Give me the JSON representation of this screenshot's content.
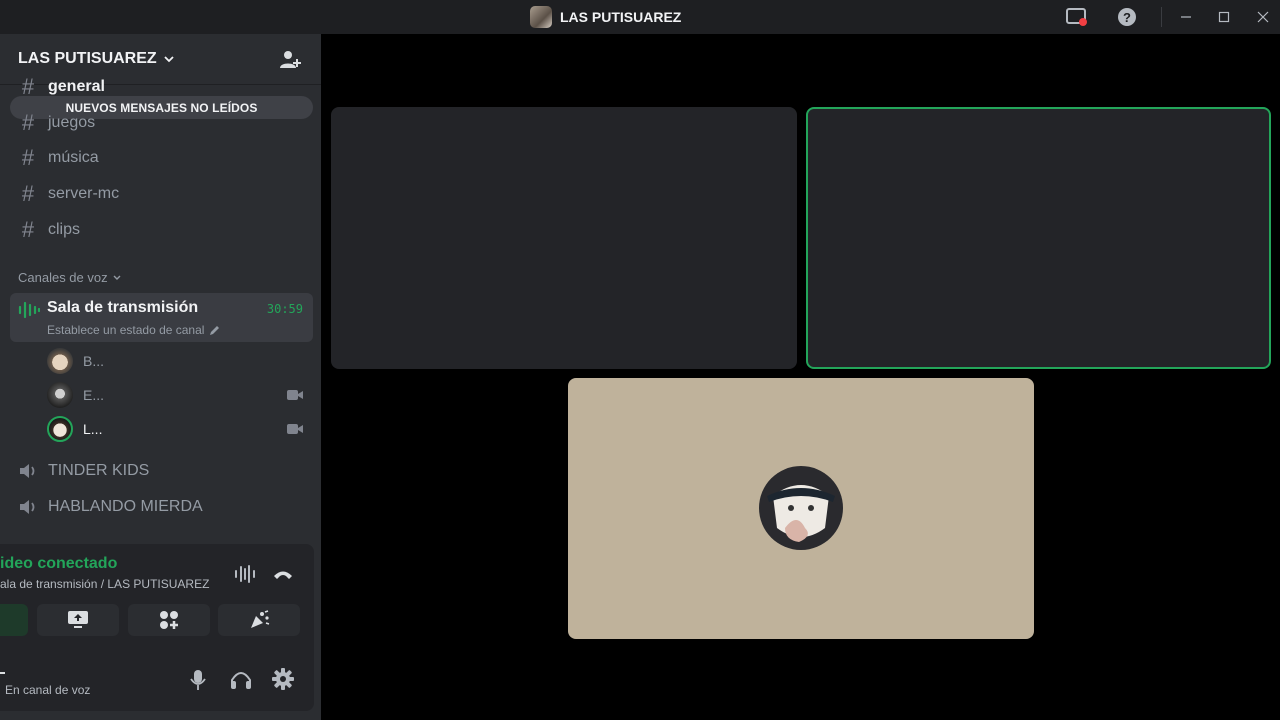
{
  "window": {
    "title": "LAS PUTISUAREZ"
  },
  "server": {
    "name": "LAS PUTISUAREZ"
  },
  "unread_banner": "NUEVOS MENSAJES NO LEÍDOS",
  "text_channels": [
    "general",
    "juegos",
    "música",
    "server-mc",
    "clips"
  ],
  "voice_category": "Canales de voz",
  "active_voice": {
    "name": "Sala de transmisión",
    "timer": "30:59",
    "status_placeholder": "Establece un estado de canal",
    "users": [
      {
        "name": "B...",
        "camera": false
      },
      {
        "name": "E...",
        "camera": true
      },
      {
        "name": "L...",
        "camera": true
      }
    ]
  },
  "voice_channels": [
    "TINDER KIDS",
    "HABLANDO MIERDA"
  ],
  "connection": {
    "title": "ideo conectado",
    "location": "ala de transmisión / LAS PUTISUAREZ"
  },
  "user_panel": {
    "status": "En canal de voz"
  },
  "colors": {
    "accent_green": "#23a55a",
    "sidebar": "#2b2d31",
    "tile": "#232428",
    "tile_beige": "#bfb29b"
  }
}
